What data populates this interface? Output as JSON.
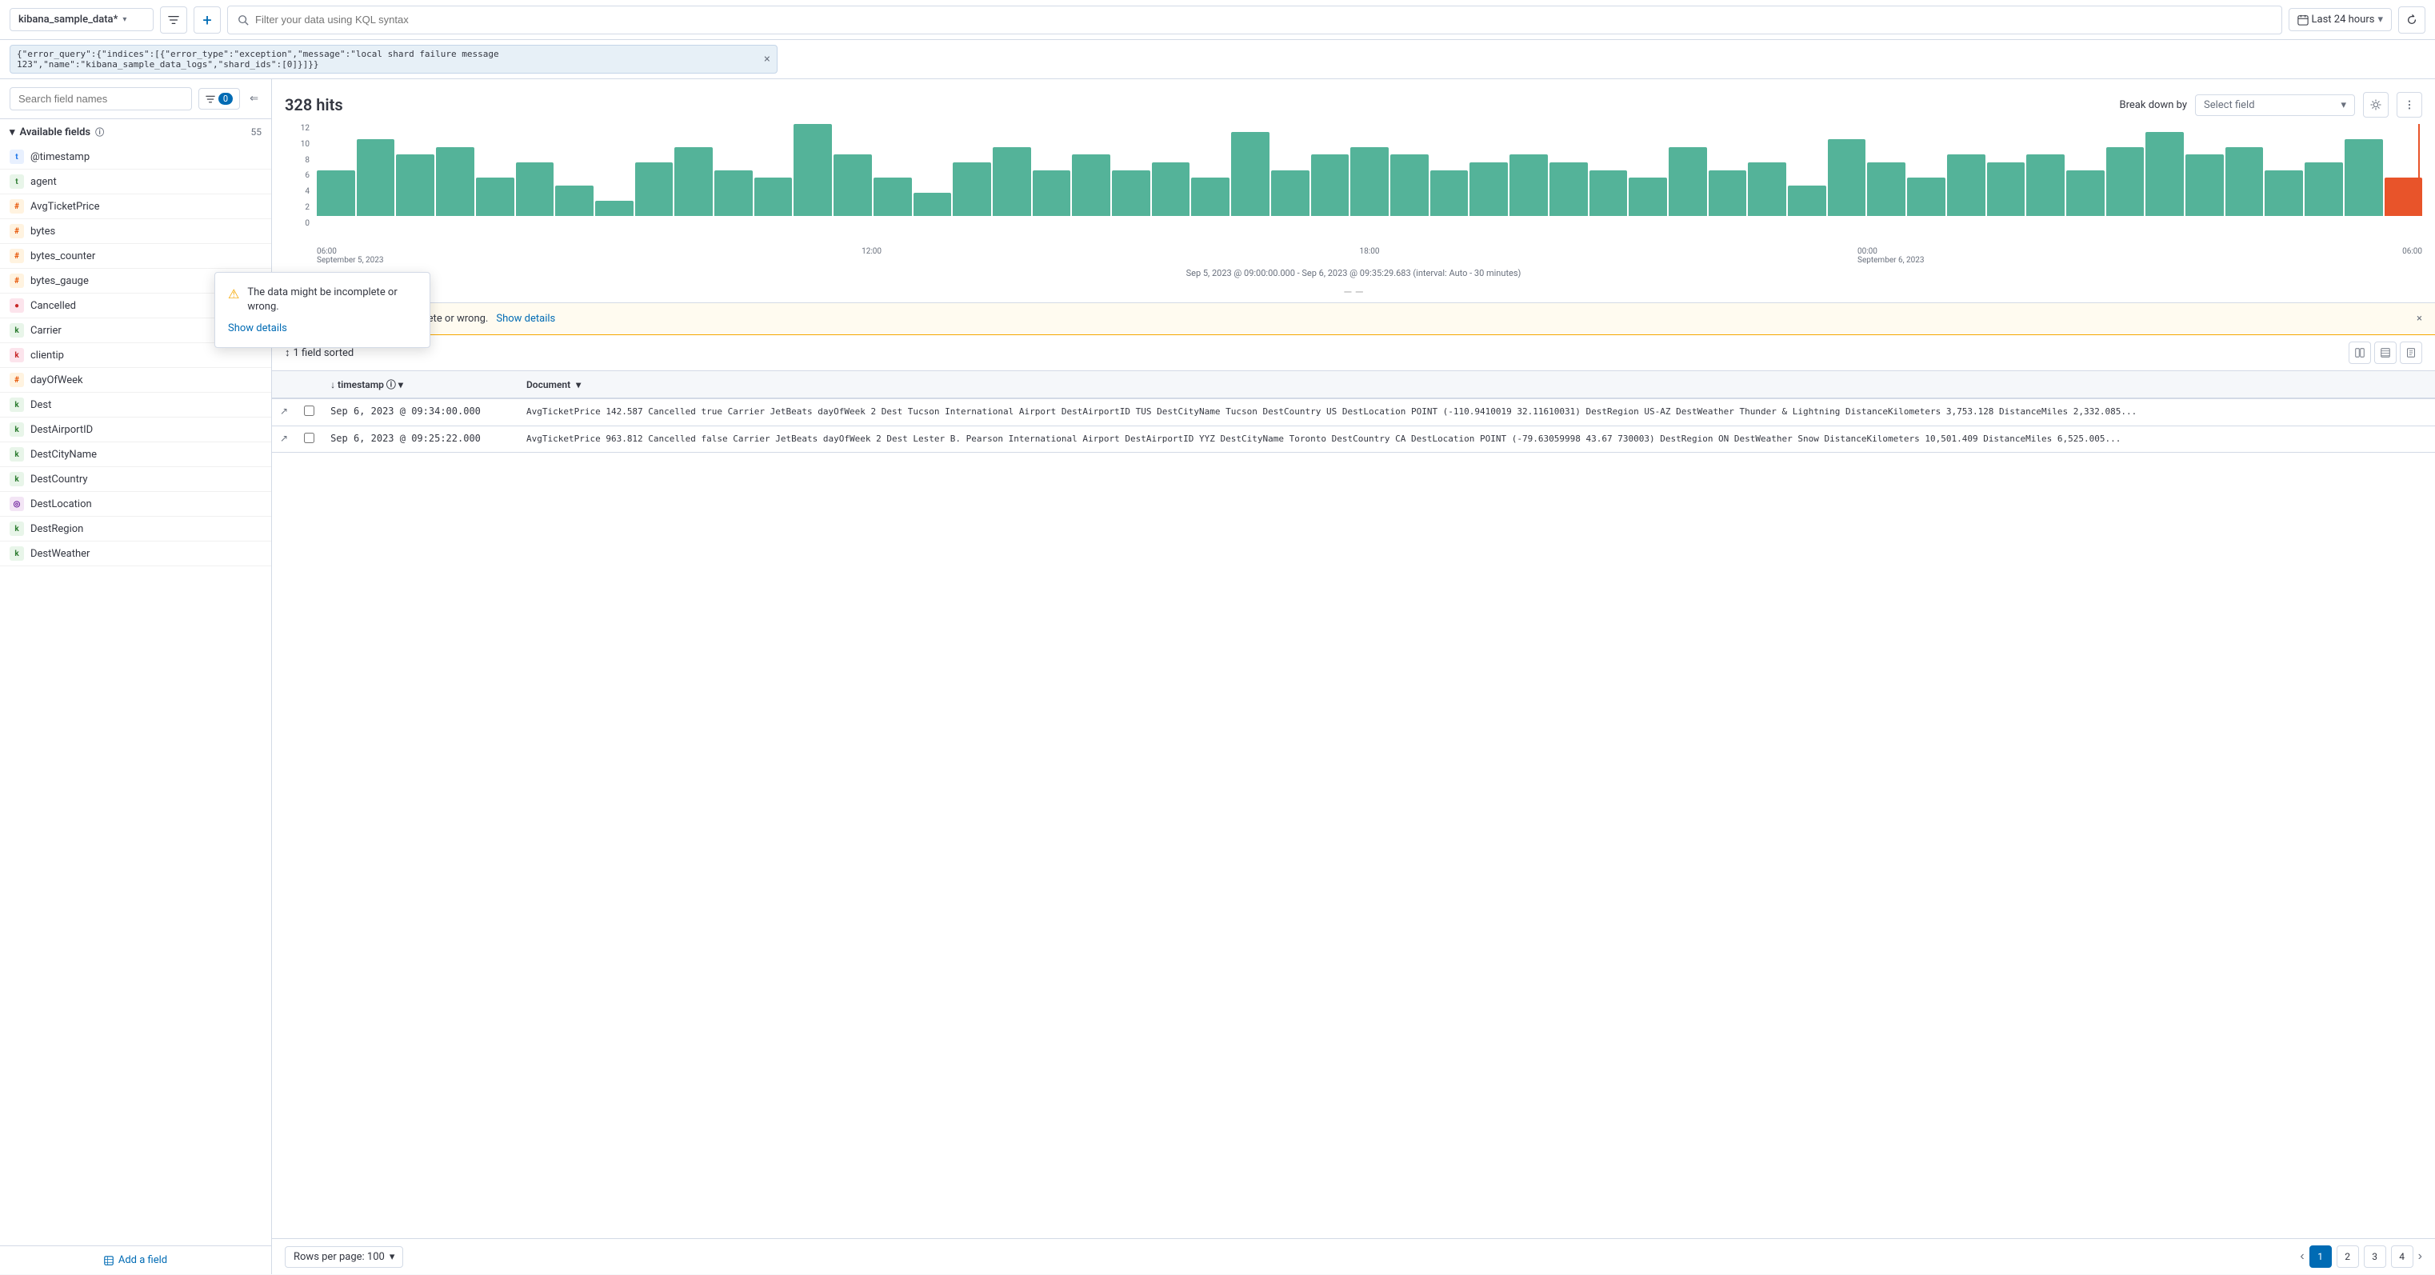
{
  "topbar": {
    "index": "kibana_sample_data*",
    "filter_placeholder": "Filter your data using KQL syntax",
    "time_range": "Last 24 hours",
    "filter_chip": "{\"error_query\":{\"indices\":[{\"error_type\":\"exception\",\"message\":\"local shard failure message 123\",\"name\":\"kibana_sample_data_logs\",\"shard_ids\":[0]}]}}"
  },
  "sidebar": {
    "search_placeholder": "Search field names",
    "filter_count": "0",
    "section_label": "Available fields",
    "section_count": "55",
    "fields": [
      {
        "name": "@timestamp",
        "type": "date",
        "type_char": "t",
        "type_class": "type-date"
      },
      {
        "name": "agent",
        "type": "text",
        "type_char": "t",
        "type_class": "type-text"
      },
      {
        "name": "AvgTicketPrice",
        "type": "number",
        "type_char": "#",
        "type_class": "type-number"
      },
      {
        "name": "bytes",
        "type": "number",
        "type_char": "#",
        "type_class": "type-number"
      },
      {
        "name": "bytes_counter",
        "type": "number",
        "type_char": "#",
        "type_class": "type-number"
      },
      {
        "name": "bytes_gauge",
        "type": "number",
        "type_char": "#",
        "type_class": "type-number"
      },
      {
        "name": "Cancelled",
        "type": "keyword",
        "type_char": "●",
        "type_class": "type-keyword"
      },
      {
        "name": "Carrier",
        "type": "keyword",
        "type_char": "k",
        "type_class": "type-text"
      },
      {
        "name": "clientip",
        "type": "keyword",
        "type_char": "k",
        "type_class": "type-keyword"
      },
      {
        "name": "dayOfWeek",
        "type": "number",
        "type_char": "#",
        "type_class": "type-number"
      },
      {
        "name": "Dest",
        "type": "keyword",
        "type_char": "k",
        "type_class": "type-text"
      },
      {
        "name": "DestAirportID",
        "type": "keyword",
        "type_char": "k",
        "type_class": "type-text"
      },
      {
        "name": "DestCityName",
        "type": "keyword",
        "type_char": "k",
        "type_class": "type-text"
      },
      {
        "name": "DestCountry",
        "type": "keyword",
        "type_char": "k",
        "type_class": "type-text"
      },
      {
        "name": "DestLocation",
        "type": "geo",
        "type_char": "◎",
        "type_class": "type-geo"
      },
      {
        "name": "DestRegion",
        "type": "keyword",
        "type_char": "k",
        "type_class": "type-text"
      },
      {
        "name": "DestWeather",
        "type": "keyword",
        "type_char": "k",
        "type_class": "type-text"
      }
    ],
    "add_field_label": "Add a field"
  },
  "chart": {
    "hits": "328 hits",
    "break_down_label": "Break down by",
    "select_field_placeholder": "Select field",
    "subtitle": "Sep 5, 2023 @ 09:00:00.000 - Sep 6, 2023 @ 09:35:29.683 (interval: Auto - 30 minutes)",
    "x_labels": [
      "06:00\nSeptember 5, 2023",
      "12:00",
      "18:00",
      "00:00\nSeptember 6, 2023",
      "06:00"
    ],
    "bars": [
      6,
      10,
      8,
      9,
      5,
      7,
      4,
      2,
      7,
      9,
      6,
      5,
      12,
      8,
      5,
      3,
      7,
      9,
      6,
      8,
      6,
      7,
      5,
      11,
      6,
      8,
      9,
      8,
      6,
      7,
      8,
      7,
      6,
      5,
      9,
      6,
      7,
      4,
      10,
      7,
      5,
      8,
      7,
      8,
      6,
      9,
      11,
      8,
      9,
      6,
      7,
      10,
      5
    ],
    "y_labels": [
      "12",
      "10",
      "8",
      "6",
      "4",
      "2",
      "0"
    ]
  },
  "warning": {
    "text": "The data might be incomplete or wrong.",
    "link_text": "Show details",
    "banner_text": "The data might be incomplete or wrong.",
    "banner_link": "Show details"
  },
  "table": {
    "sort_label": "1 field sorted",
    "columns": {
      "expand": "",
      "select": "",
      "timestamp": "timestamp",
      "document": "Document"
    },
    "rows": [
      {
        "timestamp": "Sep 6, 2023 @ 09:34:00.000",
        "document": "AvgTicketPrice 142.587 Cancelled true Carrier JetBeats dayOfWeek 2 Dest Tucson International Airport DestAirportID TUS DestCityName Tucson DestCountry US DestLocation POINT (-110.9410019 32.11610031) DestRegion US-AZ DestWeather Thunder & Lightning DistanceKilometers 3,753.128 DistanceMiles 2,332.085..."
      },
      {
        "timestamp": "Sep 6, 2023 @ 09:25:22.000",
        "document": "AvgTicketPrice 963.812 Cancelled false Carrier JetBeats dayOfWeek 2 Dest Lester B. Pearson International Airport DestAirportID YYZ DestCityName Toronto DestCountry CA DestLocation POINT (-79.63059998 43.67 730003) DestRegion ON DestWeather Snow DistanceKilometers 10,501.409 DistanceMiles 6,525.005..."
      }
    ],
    "rows_per_page_label": "Rows per page: 100",
    "pages": [
      "1",
      "2",
      "3",
      "4"
    ]
  },
  "tooltip": {
    "warning_text": "The data might be incomplete or wrong.",
    "link_text": "Show details"
  }
}
